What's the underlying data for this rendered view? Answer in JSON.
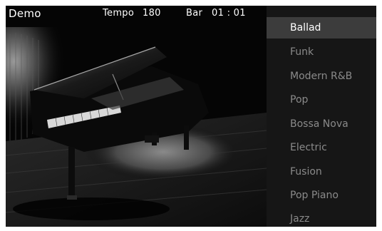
{
  "header": {
    "title": "Demo",
    "tempo_label": "Tempo",
    "tempo_value": "180",
    "bar_label": "Bar",
    "bar_value": "01 : 01"
  },
  "styles": {
    "selected_index": 0,
    "items": [
      {
        "label": "Ballad"
      },
      {
        "label": "Funk"
      },
      {
        "label": "Modern R&B"
      },
      {
        "label": "Pop"
      },
      {
        "label": "Bossa Nova"
      },
      {
        "label": "Electric"
      },
      {
        "label": "Fusion"
      },
      {
        "label": "Pop Piano"
      },
      {
        "label": "Jazz"
      }
    ]
  },
  "colors": {
    "screen_bg": "#000000",
    "menu_bg": "#161616",
    "menu_selected_bg": "#3c3c3c",
    "menu_text": "#8a8a8a",
    "menu_selected_text": "#ffffff"
  },
  "photo": {
    "subject": "grand-piano-image"
  }
}
